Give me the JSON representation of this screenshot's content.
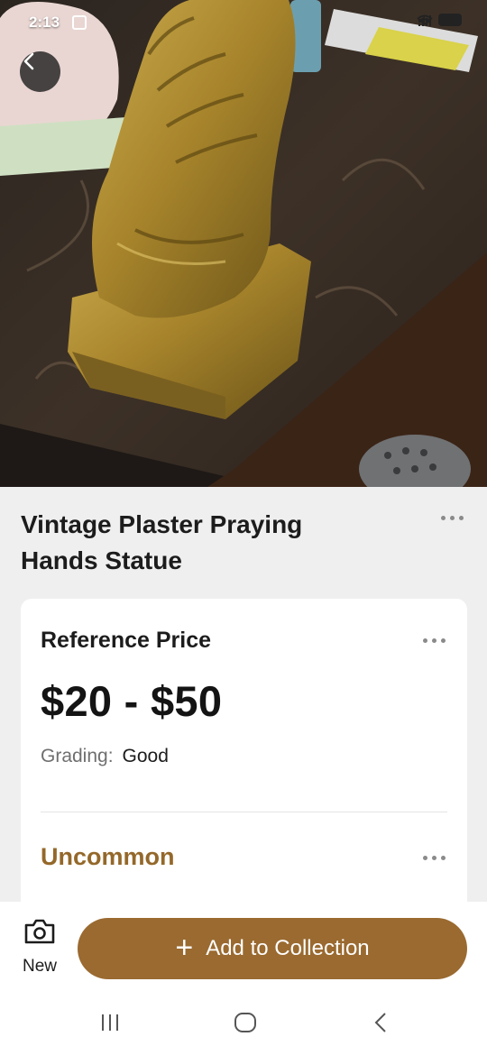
{
  "status_bar": {
    "time": "2:13"
  },
  "hero": {
    "back_icon": "chevron-left-icon"
  },
  "item": {
    "title": "Vintage Plaster Praying Hands Statue"
  },
  "card": {
    "heading": "Reference Price",
    "price": "$20 - $50",
    "grading_label": "Grading:",
    "grading_value": "Good",
    "rarity": "Uncommon",
    "rarity_color": "#94682a"
  },
  "actions": {
    "new_label": "New",
    "new_icon": "camera-icon",
    "add_label": "Add to Collection",
    "add_icon": "plus-icon",
    "accent": "#9a6a30"
  },
  "nav": {
    "recents_icon": "recents-icon",
    "home_icon": "home-icon",
    "back_icon": "back-icon"
  }
}
